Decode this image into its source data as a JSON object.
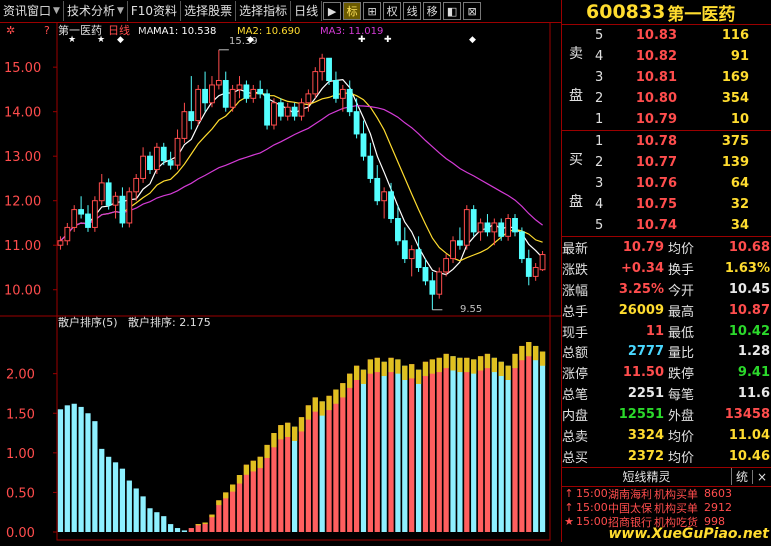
{
  "toolbar": {
    "buttons": [
      "资讯窗口",
      "技术分析",
      "F10资料",
      "选择股票",
      "选择指标",
      "日线"
    ],
    "icons": [
      {
        "name": "play-icon",
        "glyph": "▶",
        "active": false
      },
      {
        "name": "mark-icon",
        "glyph": "标",
        "active": true
      },
      {
        "name": "cross-icon",
        "glyph": "⊞",
        "active": false
      },
      {
        "name": "rights-icon",
        "glyph": "权",
        "active": false
      },
      {
        "name": "line-icon",
        "glyph": "线",
        "active": false
      },
      {
        "name": "move-icon",
        "glyph": "移",
        "active": false
      },
      {
        "name": "panel-toggle-icon",
        "glyph": "◧",
        "active": false
      },
      {
        "name": "close-window-icon",
        "glyph": "⊠",
        "active": false
      }
    ]
  },
  "stock": {
    "code": "600833",
    "name": "第一医药"
  },
  "main_chart": {
    "title": "第一医药",
    "period": "日线",
    "ma_label": "MA",
    "ma1_label": "MA1: 10.538",
    "ma2_label": "MA2: 10.690",
    "ma3_label": "MA3: 11.019",
    "high_annot": "15.39",
    "low_annot": "9.55"
  },
  "sub_chart": {
    "title": "散户排序(5)",
    "value_label": "散户排序: 2.175"
  },
  "colors": {
    "up": "#ff4d4d",
    "down": "#54ffff",
    "ma1": "#ffffff",
    "ma2": "#ffdc2f",
    "ma3": "#d43bd6",
    "grid": "#9b0000",
    "sub_red": "#ff5f5f",
    "sub_cyan": "#8ef0ff",
    "sub_yellow": "#e0c020"
  },
  "order_book": {
    "sell_label": [
      "卖",
      "盘"
    ],
    "buy_label": [
      "买",
      "盘"
    ],
    "sell": [
      {
        "level": "5",
        "price": "10.83",
        "vol": "116"
      },
      {
        "level": "4",
        "price": "10.82",
        "vol": "91"
      },
      {
        "level": "3",
        "price": "10.81",
        "vol": "169"
      },
      {
        "level": "2",
        "price": "10.80",
        "vol": "354"
      },
      {
        "level": "1",
        "price": "10.79",
        "vol": "10"
      }
    ],
    "buy": [
      {
        "level": "1",
        "price": "10.78",
        "vol": "375"
      },
      {
        "level": "2",
        "price": "10.77",
        "vol": "139"
      },
      {
        "level": "3",
        "price": "10.76",
        "vol": "64"
      },
      {
        "level": "4",
        "price": "10.75",
        "vol": "32"
      },
      {
        "level": "5",
        "price": "10.74",
        "vol": "34"
      }
    ]
  },
  "quote": [
    {
      "k1": "最新",
      "v1": "10.79",
      "c1": "red",
      "k2": "均价",
      "v2": "10.68",
      "c2": "red"
    },
    {
      "k1": "涨跌",
      "v1": "+0.34",
      "c1": "red",
      "k2": "换手",
      "v2": "1.63%",
      "c2": "yellow"
    },
    {
      "k1": "涨幅",
      "v1": "3.25%",
      "c1": "red",
      "k2": "今开",
      "v2": "10.45",
      "c2": "white"
    },
    {
      "k1": "总手",
      "v1": "26009",
      "c1": "yellow",
      "k2": "最高",
      "v2": "10.87",
      "c2": "red"
    },
    {
      "k1": "现手",
      "v1": "11",
      "c1": "red",
      "k2": "最低",
      "v2": "10.42",
      "c2": "green"
    },
    {
      "k1": "总额",
      "v1": "2777",
      "c1": "cyan",
      "k2": "量比",
      "v2": "1.28",
      "c2": "white"
    },
    {
      "k1": "涨停",
      "v1": "11.50",
      "c1": "red",
      "k2": "跌停",
      "v2": "9.41",
      "c2": "green"
    },
    {
      "k1": "总笔",
      "v1": "2251",
      "c1": "white",
      "k2": "每笔",
      "v2": "11.6",
      "c2": "white"
    },
    {
      "k1": "内盘",
      "v1": "12551",
      "c1": "green",
      "k2": "外盘",
      "v2": "13458",
      "c2": "red"
    },
    {
      "k1": "总卖",
      "v1": "3324",
      "c1": "yellow",
      "k2": "均价",
      "v2": "11.04",
      "c2": "yellow"
    },
    {
      "k1": "总买",
      "v1": "2372",
      "c1": "yellow",
      "k2": "均价",
      "v2": "10.46",
      "c2": "yellow"
    }
  ],
  "sprite": {
    "title": "短线精灵",
    "tab": "统",
    "close": "×",
    "rows": [
      {
        "arrow": "↑",
        "time": "15:00",
        "name": "湖南海利",
        "event": "机构买单",
        "vol": "8603"
      },
      {
        "arrow": "↑",
        "time": "15:00",
        "name": "中国太保",
        "event": "机构买单",
        "vol": "2912"
      },
      {
        "arrow": "★",
        "time": "15:00",
        "name": "招商银行",
        "event": "机构吃货",
        "vol": "998"
      }
    ]
  },
  "watermark": "www.XueGuPiao.net",
  "chart_data": [
    {
      "type": "candlestick",
      "title": "第一医药 日线",
      "ylim": [
        9.5,
        15.7
      ],
      "yticks": [
        10.0,
        11.0,
        12.0,
        13.0,
        14.0,
        15.0
      ],
      "ytick_labels": [
        "10.00",
        "11.00",
        "12.00",
        "13.00",
        "14.00",
        "15.00"
      ],
      "ohlc": [
        [
          11.0,
          11.2,
          10.9,
          11.1
        ],
        [
          11.1,
          11.5,
          11.0,
          11.4
        ],
        [
          11.4,
          11.9,
          11.3,
          11.8
        ],
        [
          11.8,
          12.1,
          11.6,
          11.7
        ],
        [
          11.7,
          11.9,
          11.3,
          11.4
        ],
        [
          11.4,
          12.1,
          11.3,
          12.0
        ],
        [
          12.0,
          12.6,
          11.9,
          12.4
        ],
        [
          12.4,
          12.5,
          11.8,
          11.9
        ],
        [
          11.9,
          12.2,
          11.6,
          12.1
        ],
        [
          12.1,
          12.3,
          11.4,
          11.5
        ],
        [
          11.5,
          12.3,
          11.4,
          12.2
        ],
        [
          12.2,
          12.6,
          12.0,
          12.5
        ],
        [
          12.5,
          13.2,
          12.4,
          13.0
        ],
        [
          13.0,
          13.1,
          12.6,
          12.7
        ],
        [
          12.7,
          13.3,
          12.6,
          13.2
        ],
        [
          13.2,
          13.3,
          12.8,
          12.9
        ],
        [
          12.9,
          13.1,
          12.7,
          12.8
        ],
        [
          12.8,
          13.6,
          12.7,
          13.4
        ],
        [
          13.4,
          14.2,
          13.3,
          14.0
        ],
        [
          14.0,
          14.8,
          13.6,
          13.8
        ],
        [
          13.8,
          14.6,
          13.7,
          14.5
        ],
        [
          14.5,
          14.9,
          14.0,
          14.2
        ],
        [
          14.2,
          14.8,
          14.1,
          14.6
        ],
        [
          14.6,
          15.39,
          14.5,
          14.7
        ],
        [
          14.7,
          14.9,
          14.0,
          14.1
        ],
        [
          14.1,
          14.6,
          14.0,
          14.5
        ],
        [
          14.5,
          14.8,
          14.3,
          14.6
        ],
        [
          14.6,
          14.7,
          14.2,
          14.3
        ],
        [
          14.3,
          14.6,
          14.2,
          14.5
        ],
        [
          14.5,
          14.7,
          14.3,
          14.4
        ],
        [
          14.4,
          14.5,
          13.6,
          13.7
        ],
        [
          13.7,
          14.3,
          13.6,
          14.2
        ],
        [
          14.2,
          14.3,
          13.8,
          13.9
        ],
        [
          13.9,
          14.2,
          13.8,
          14.1
        ],
        [
          14.1,
          14.2,
          13.8,
          13.9
        ],
        [
          13.9,
          14.3,
          13.8,
          14.2
        ],
        [
          14.2,
          14.5,
          14.0,
          14.4
        ],
        [
          14.4,
          15.0,
          14.3,
          14.9
        ],
        [
          14.9,
          15.3,
          14.7,
          15.2
        ],
        [
          15.2,
          15.2,
          14.6,
          14.7
        ],
        [
          14.7,
          14.9,
          14.2,
          14.3
        ],
        [
          14.3,
          14.6,
          14.0,
          14.5
        ],
        [
          14.5,
          14.7,
          13.9,
          14.0
        ],
        [
          14.0,
          14.3,
          13.4,
          13.5
        ],
        [
          13.5,
          13.8,
          12.9,
          13.0
        ],
        [
          13.0,
          13.3,
          12.4,
          12.5
        ],
        [
          12.5,
          12.8,
          11.9,
          12.0
        ],
        [
          12.0,
          12.3,
          11.6,
          12.2
        ],
        [
          12.2,
          12.4,
          11.5,
          11.6
        ],
        [
          11.6,
          11.9,
          11.0,
          11.1
        ],
        [
          11.1,
          11.4,
          10.6,
          10.7
        ],
        [
          10.7,
          11.0,
          10.3,
          10.9
        ],
        [
          10.9,
          11.2,
          10.4,
          10.5
        ],
        [
          10.5,
          10.7,
          10.1,
          10.2
        ],
        [
          10.2,
          10.4,
          9.55,
          9.9
        ],
        [
          9.9,
          10.5,
          9.8,
          10.4
        ],
        [
          10.4,
          10.8,
          10.3,
          10.7
        ],
        [
          10.7,
          11.2,
          10.6,
          11.1
        ],
        [
          11.1,
          11.4,
          10.9,
          11.0
        ],
        [
          11.0,
          11.9,
          10.9,
          11.8
        ],
        [
          11.8,
          11.9,
          11.2,
          11.3
        ],
        [
          11.3,
          11.6,
          11.1,
          11.5
        ],
        [
          11.5,
          11.7,
          11.2,
          11.3
        ],
        [
          11.3,
          11.6,
          11.0,
          11.5
        ],
        [
          11.5,
          11.6,
          11.1,
          11.2
        ],
        [
          11.2,
          11.7,
          11.1,
          11.6
        ],
        [
          11.6,
          11.7,
          11.2,
          11.3
        ],
        [
          11.3,
          11.4,
          10.6,
          10.7
        ],
        [
          10.7,
          10.9,
          10.1,
          10.3
        ],
        [
          10.3,
          10.6,
          10.2,
          10.5
        ],
        [
          10.45,
          10.87,
          10.42,
          10.79
        ]
      ]
    },
    {
      "type": "bar",
      "title": "散户排序(5)",
      "ylim": [
        0,
        2.4
      ],
      "yticks": [
        0.0,
        0.5,
        1.0,
        1.5,
        2.0
      ],
      "ytick_labels": [
        "0.00",
        "0.50",
        "1.00",
        "1.50",
        "2.00"
      ],
      "series": [
        {
          "name": "散户排序",
          "values": [
            1.55,
            1.6,
            1.62,
            1.58,
            1.5,
            1.4,
            1.05,
            0.95,
            0.88,
            0.8,
            0.65,
            0.55,
            0.45,
            0.3,
            0.25,
            0.2,
            0.1,
            0.05,
            0.02,
            0.05,
            0.1,
            0.12,
            0.22,
            0.4,
            0.5,
            0.6,
            0.72,
            0.85,
            0.9,
            0.95,
            1.1,
            1.25,
            1.35,
            1.38,
            1.33,
            1.45,
            1.6,
            1.7,
            1.65,
            1.72,
            1.8,
            1.88,
            2.0,
            2.1,
            2.05,
            2.18,
            2.2,
            2.15,
            2.2,
            2.18,
            2.1,
            2.12,
            2.05,
            2.15,
            2.18,
            2.2,
            2.25,
            2.22,
            2.2,
            2.2,
            2.18,
            2.22,
            2.25,
            2.2,
            2.15,
            2.1,
            2.25,
            2.35,
            2.4,
            2.35,
            2.28
          ]
        }
      ]
    }
  ]
}
